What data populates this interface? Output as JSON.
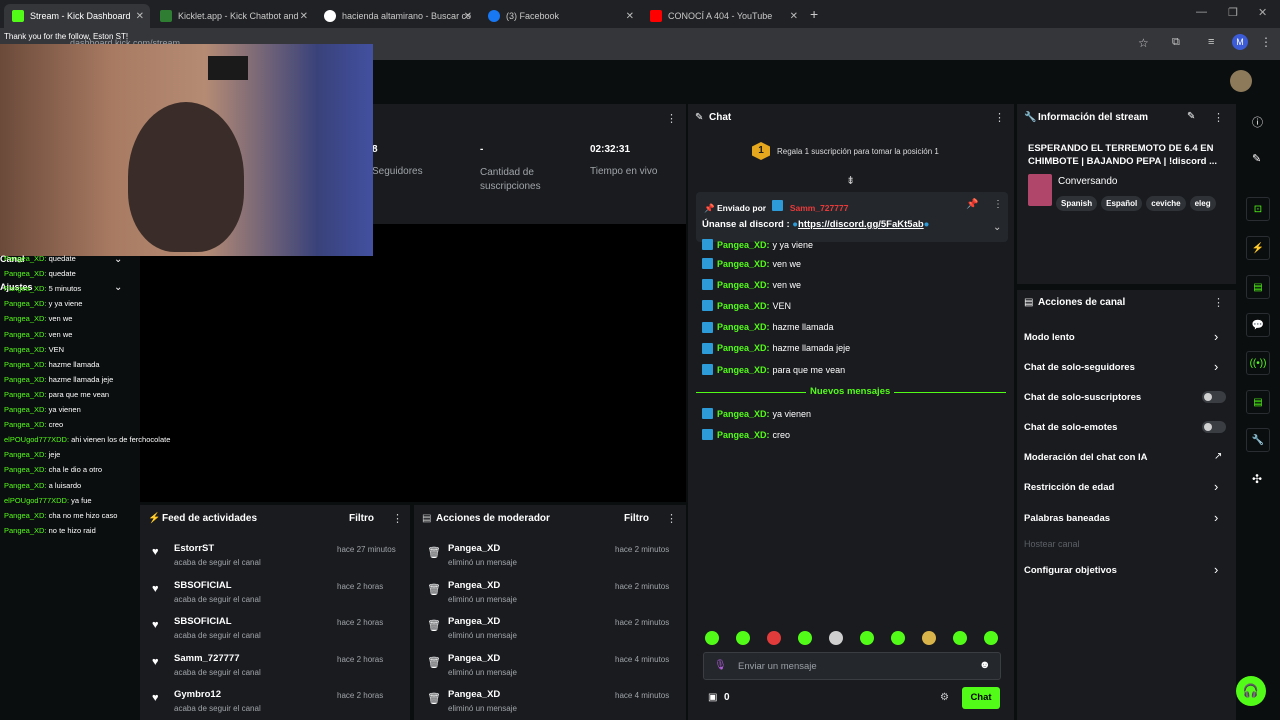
{
  "browser": {
    "tabs": [
      {
        "label": "Stream - Kick Dashboard",
        "icon": "kick-icon",
        "active": true
      },
      {
        "label": "Kicklet.app - Kick Chatbot and",
        "icon": "kicklet-icon"
      },
      {
        "label": "hacienda altamirano - Buscar co",
        "icon": "google-icon"
      },
      {
        "label": "(3) Facebook",
        "icon": "facebook-icon"
      },
      {
        "label": "CONOCÍ A 404 - YouTube",
        "icon": "youtube-icon"
      }
    ],
    "close": "✕",
    "new_tab": "+",
    "address": "dashboard.kick.com/stream",
    "profile_initial": "M"
  },
  "overlay": {
    "top_text": "Thank you for the follow, Eston ST!",
    "side_labels": {
      "canal": "Canal",
      "ajustes": "Ajustes"
    },
    "chat": [
      {
        "user": "Pangea_XD:",
        "msg": "quedate"
      },
      {
        "user": "Pangea_XD:",
        "msg": "quedate"
      },
      {
        "user": "Pangea_XD:",
        "msg": "5 minutos"
      },
      {
        "user": "Pangea_XD:",
        "msg": "y ya viene"
      },
      {
        "user": "Pangea_XD:",
        "msg": "ven we"
      },
      {
        "user": "Pangea_XD:",
        "msg": "ven we"
      },
      {
        "user": "Pangea_XD:",
        "msg": "VEN"
      },
      {
        "user": "Pangea_XD:",
        "msg": "hazme llamada"
      },
      {
        "user": "Pangea_XD:",
        "msg": "hazme llamada jeje"
      },
      {
        "user": "Pangea_XD:",
        "msg": "para que me vean"
      },
      {
        "user": "Pangea_XD:",
        "msg": "ya vienen"
      },
      {
        "user": "Pangea_XD:",
        "msg": "creo"
      },
      {
        "user": "elPOUgod777XDD:",
        "msg": "ahi vienen los de ferchocolate"
      },
      {
        "user": "Pangea_XD:",
        "msg": "jeje"
      },
      {
        "user": "Pangea_XD:",
        "msg": "cha le dio a otro"
      },
      {
        "user": "Pangea_XD:",
        "msg": "a luisardo"
      },
      {
        "user": "elPOUgod777XDD:",
        "msg": "ya fue"
      },
      {
        "user": "Pangea_XD:",
        "msg": "cha no me hizo caso"
      },
      {
        "user": "Pangea_XD:",
        "msg": "no te hizo raid"
      }
    ]
  },
  "stats": {
    "followers_value": "8",
    "followers_label": "Seguidores",
    "subs_value": "-",
    "subs_label": "Cantidad de suscripciones",
    "time_value": "02:32:31",
    "time_label": "Tiempo en vivo"
  },
  "activity_feed": {
    "title": "Feed de actividades",
    "filter": "Filtro",
    "items": [
      {
        "name": "EstorrST",
        "sub": "acaba de seguir el canal",
        "time": "hace 27 minutos"
      },
      {
        "name": "SBSOFICIAL",
        "sub": "acaba de seguir el canal",
        "time": "hace 2 horas"
      },
      {
        "name": "SBSOFICIAL",
        "sub": "acaba de seguir el canal",
        "time": "hace 2 horas"
      },
      {
        "name": "Samm_727777",
        "sub": "acaba de seguir el canal",
        "time": "hace 2 horas"
      },
      {
        "name": "Gymbro12",
        "sub": "acaba de seguir el canal",
        "time": "hace 2 horas"
      }
    ]
  },
  "mod_actions": {
    "title": "Acciones de moderador",
    "filter": "Filtro",
    "items": [
      {
        "name": "Pangea_XD",
        "sub": "eliminó un mensaje",
        "time": "hace 2 minutos"
      },
      {
        "name": "Pangea_XD",
        "sub": "eliminó un mensaje",
        "time": "hace 2 minutos"
      },
      {
        "name": "Pangea_XD",
        "sub": "eliminó un mensaje",
        "time": "hace 2 minutos"
      },
      {
        "name": "Pangea_XD",
        "sub": "eliminó un mensaje",
        "time": "hace 4 minutos"
      },
      {
        "name": "Pangea_XD",
        "sub": "eliminó un mensaje",
        "time": "hace 4 minutos"
      }
    ]
  },
  "chat": {
    "title": "Chat",
    "sub_goal_rank": "1",
    "sub_goal": "Regala 1 suscripción para tomar la posición 1",
    "pinned_by_label": "Enviado por",
    "pinned_by_user": "Samm_727777",
    "pinned_msg": "Únanse al discord :",
    "pinned_link": "https://discord.gg/5FaKt5ab",
    "new_messages": "Nuevos mensajes",
    "messages": [
      {
        "user": "Pangea_XD:",
        "msg": "y ya viene"
      },
      {
        "user": "Pangea_XD:",
        "msg": "ven we"
      },
      {
        "user": "Pangea_XD:",
        "msg": "ven we"
      },
      {
        "user": "Pangea_XD:",
        "msg": "VEN"
      },
      {
        "user": "Pangea_XD:",
        "msg": "hazme llamada"
      },
      {
        "user": "Pangea_XD:",
        "msg": "hazme llamada jeje"
      },
      {
        "user": "Pangea_XD:",
        "msg": "para que me vean"
      }
    ],
    "new": [
      {
        "user": "Pangea_XD:",
        "msg": "ya vienen"
      },
      {
        "user": "Pangea_XD:",
        "msg": "creo"
      }
    ],
    "input_placeholder": "Enviar un mensaje",
    "kicks_count": "0",
    "send_label": "Chat"
  },
  "stream_info": {
    "title": "Información del stream",
    "stream_title": "ESPERANDO EL TERREMOTO DE 6.4 EN CHIMBOTE | BAJANDO PEPA | !discord ...",
    "category": "Conversando",
    "tags": [
      "Spanish",
      "Español",
      "ceviche",
      "eleg"
    ]
  },
  "channel_actions": {
    "title": "Acciones de canal",
    "items": [
      {
        "label": "Modo lento",
        "type": "chevron"
      },
      {
        "label": "Chat de solo-seguidores",
        "type": "chevron"
      },
      {
        "label": "Chat de solo-suscriptores",
        "type": "toggle"
      },
      {
        "label": "Chat de solo-emotes",
        "type": "toggle"
      },
      {
        "label": "Moderación del chat con IA",
        "type": "external"
      },
      {
        "label": "Restricción de edad",
        "type": "chevron"
      },
      {
        "label": "Palabras baneadas",
        "type": "chevron"
      },
      {
        "label": "Hostear canal",
        "type": "disabled"
      },
      {
        "label": "Configurar objetivos",
        "type": "chevron"
      }
    ]
  },
  "colors": {
    "accent": "#53fc18",
    "panel": "#191b1f",
    "bg": "#0b0e0f"
  }
}
